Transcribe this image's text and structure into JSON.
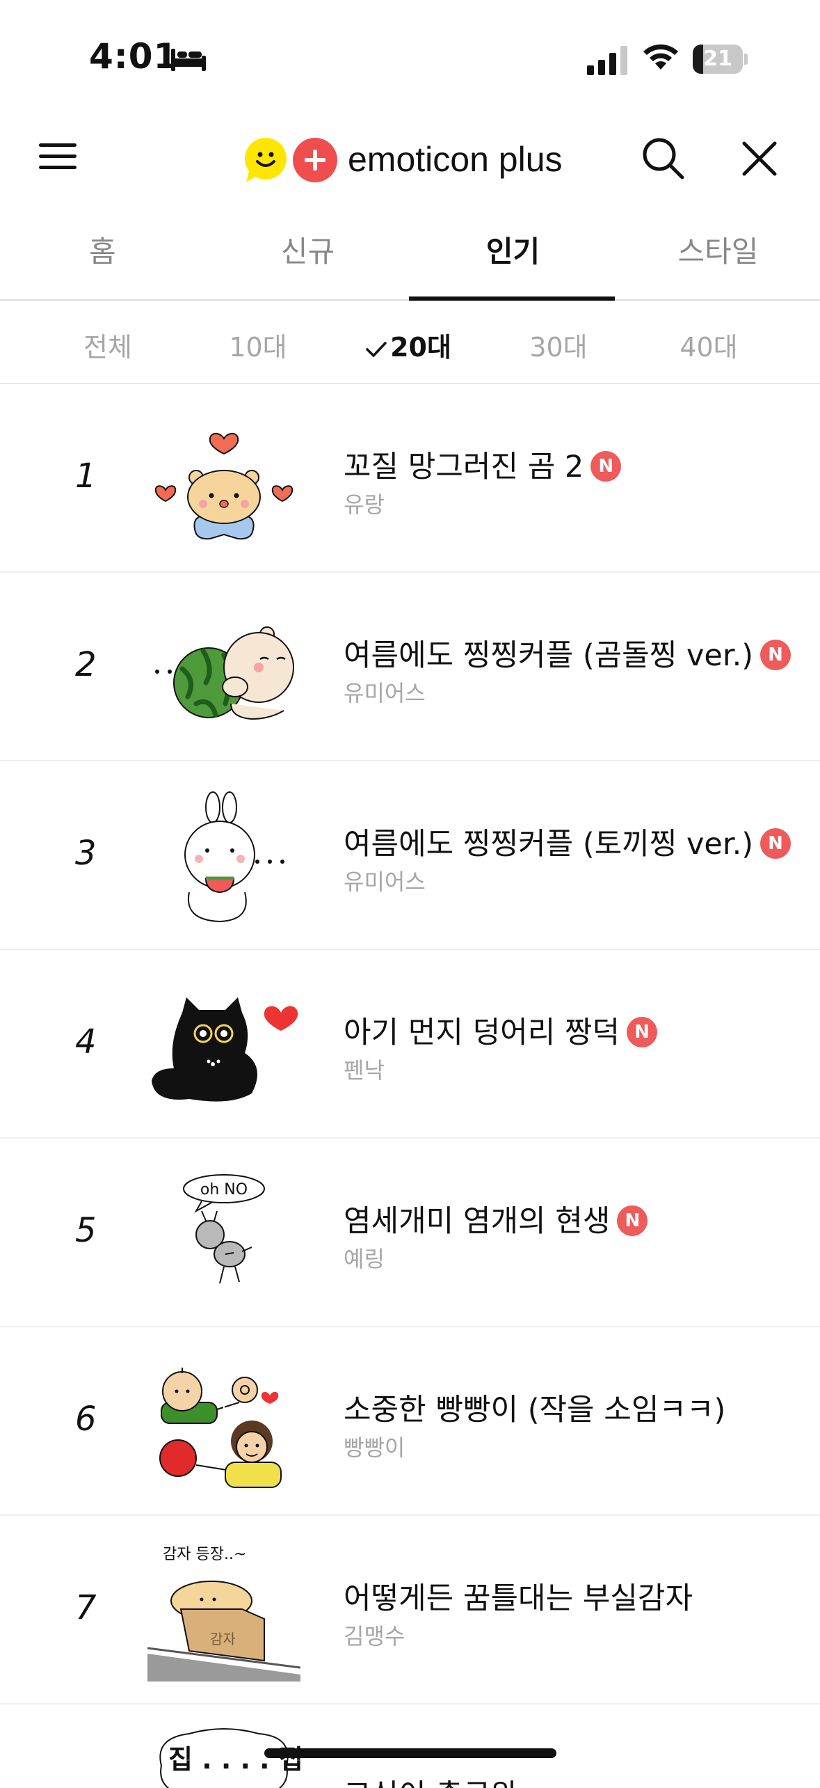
{
  "status": {
    "time": "4:01",
    "battery": "21",
    "battery_level": 0.21
  },
  "header": {
    "logo_text": "emoticon plus"
  },
  "tabs": [
    {
      "label": "홈",
      "active": false
    },
    {
      "label": "신규",
      "active": false
    },
    {
      "label": "인기",
      "active": true
    },
    {
      "label": "스타일",
      "active": false
    }
  ],
  "ages": [
    {
      "label": "전체",
      "active": false
    },
    {
      "label": "10대",
      "active": false
    },
    {
      "label": "20대",
      "active": true
    },
    {
      "label": "30대",
      "active": false
    },
    {
      "label": "40대",
      "active": false
    }
  ],
  "badge_label": "N",
  "items": [
    {
      "rank": "1",
      "title": "꼬질 망그러진 곰 2",
      "author": "유랑",
      "is_new": true
    },
    {
      "rank": "2",
      "title": "여름에도 찡찡커플 (곰돌찡 ver.)",
      "author": "유미어스",
      "is_new": true
    },
    {
      "rank": "3",
      "title": "여름에도 찡찡커플 (토끼찡 ver.)",
      "author": "유미어스",
      "is_new": true
    },
    {
      "rank": "4",
      "title": "아기 먼지 덩어리 짱덕",
      "author": "펜낙",
      "is_new": true
    },
    {
      "rank": "5",
      "title": "염세개미 염개의 현생",
      "author": "예링",
      "is_new": true
    },
    {
      "rank": "6",
      "title": "소중한 빵빵이 (작을 소임ㅋㅋ)",
      "author": "빵빵이",
      "is_new": false
    },
    {
      "rank": "7",
      "title": "어떻게든 꿈틀대는 부실감자",
      "author": "김맹수",
      "is_new": false
    },
    {
      "rank": "",
      "title": "고심이 출근완",
      "author": "",
      "is_new": false
    }
  ],
  "thumb_text": {
    "item5_bubble": "oh NO",
    "item7_caption": "감자 등장..~",
    "item7_box": "감자",
    "item8_bubble": "집 . . . . 집 . . . 집"
  },
  "colors": {
    "accent_red": "#ef5a5a",
    "logo_yellow": "#ffe600",
    "text_primary": "#111111",
    "text_secondary": "#a6a6a6"
  }
}
